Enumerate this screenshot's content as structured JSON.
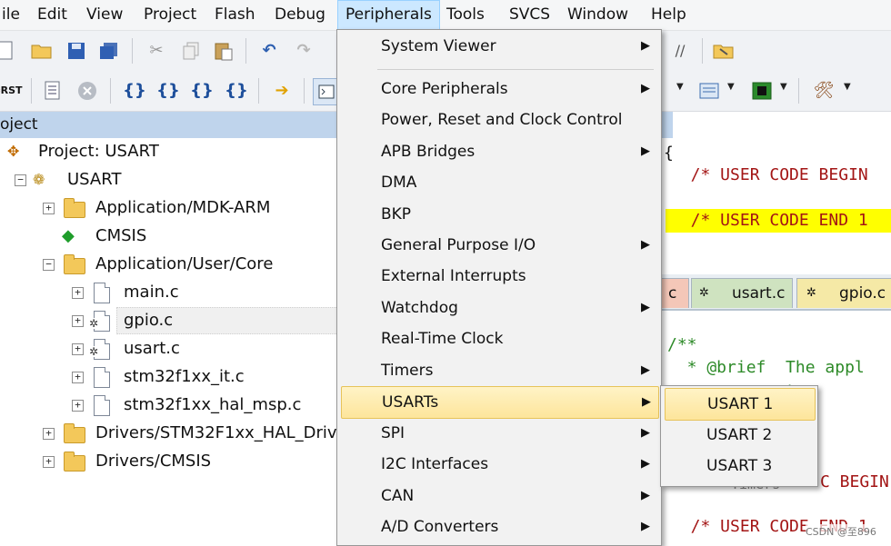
{
  "menubar": {
    "items": [
      "ile",
      "Edit",
      "View",
      "Project",
      "Flash",
      "Debug",
      "Peripherals",
      "Tools",
      "SVCS",
      "Window",
      "Help"
    ],
    "active": "Peripherals"
  },
  "toolbar2": {
    "reset_label": "RST"
  },
  "project_pane": {
    "header": "oject",
    "tree": [
      {
        "label": "Project: USART",
        "kind": "project"
      },
      {
        "label": "USART",
        "kind": "target"
      },
      {
        "label": "Application/MDK-ARM",
        "kind": "folder"
      },
      {
        "label": "CMSIS",
        "kind": "component"
      },
      {
        "label": "Application/User/Core",
        "kind": "folder"
      },
      {
        "label": "main.c",
        "kind": "file"
      },
      {
        "label": "gpio.c",
        "kind": "file"
      },
      {
        "label": "usart.c",
        "kind": "file"
      },
      {
        "label": "stm32f1xx_it.c",
        "kind": "file"
      },
      {
        "label": "stm32f1xx_hal_msp.c",
        "kind": "file"
      },
      {
        "label": "Drivers/STM32F1xx_HAL_Driver",
        "kind": "folder"
      },
      {
        "label": "Drivers/CMSIS",
        "kind": "folder"
      }
    ]
  },
  "editor": {
    "lines_top": [
      "{",
      "  /* USER CODE BEGIN",
      "  /* USER CODE END 1"
    ],
    "tabs": [
      "c",
      "usart.c",
      "gpio.c"
    ],
    "lines_bottom": [
      "/**",
      "  * @brief  The appl",
      "           nt",
      "Timers",
      "C BEGIN",
      "  /* USER CODE END 1"
    ]
  },
  "peripherals_menu": {
    "items": [
      {
        "label": "System Viewer",
        "submenu": true
      },
      {
        "label": "Core Peripherals",
        "submenu": true
      },
      {
        "label": "Power, Reset and Clock Control",
        "submenu": false
      },
      {
        "label": "APB Bridges",
        "submenu": true
      },
      {
        "label": "DMA",
        "submenu": false
      },
      {
        "label": "BKP",
        "submenu": false
      },
      {
        "label": "General Purpose I/O",
        "submenu": true
      },
      {
        "label": "External Interrupts",
        "submenu": false
      },
      {
        "label": "Watchdog",
        "submenu": true
      },
      {
        "label": "Real-Time Clock",
        "submenu": false
      },
      {
        "label": "Timers",
        "submenu": true
      },
      {
        "label": "USARTs",
        "submenu": true
      },
      {
        "label": "SPI",
        "submenu": true
      },
      {
        "label": "I2C Interfaces",
        "submenu": true
      },
      {
        "label": "CAN",
        "submenu": true
      },
      {
        "label": "A/D Converters",
        "submenu": true
      }
    ],
    "highlighted": "USARTs"
  },
  "usart_submenu": {
    "items": [
      "USART 1",
      "USART 2",
      "USART 3"
    ],
    "highlighted": "USART 1"
  },
  "watermark": "CSDN @至896",
  "colors": {
    "menu_active_bg": "#cce8ff",
    "menu_highlight": "#fde59b",
    "code_comment_red": "#a31515",
    "code_green": "#2d8a28",
    "highlight_yellow": "#ffff00",
    "project_header_bg": "#bfd4ec"
  }
}
